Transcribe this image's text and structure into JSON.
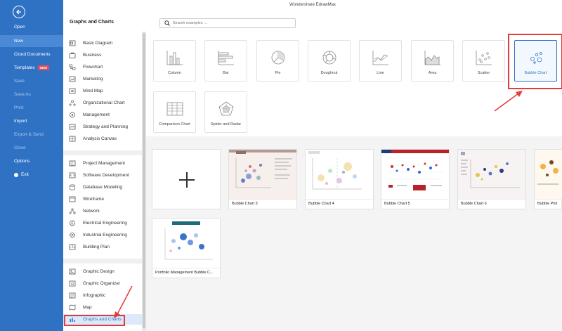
{
  "window": {
    "title": "Wondershare EdrawMax"
  },
  "leftnav": {
    "items": [
      {
        "label": "Open",
        "state": "normal"
      },
      {
        "label": "New",
        "state": "active"
      },
      {
        "label": "Cloud Documents",
        "state": "normal"
      },
      {
        "label": "Templates",
        "state": "normal",
        "badge": "NEW"
      },
      {
        "label": "Save",
        "state": "dim"
      },
      {
        "label": "Save As",
        "state": "dim"
      },
      {
        "label": "Print",
        "state": "dim"
      },
      {
        "label": "Import",
        "state": "normal"
      },
      {
        "label": "Export & Send",
        "state": "dim"
      },
      {
        "label": "Close",
        "state": "dim"
      },
      {
        "label": "Options",
        "state": "normal"
      },
      {
        "label": "Exit",
        "state": "normal"
      }
    ]
  },
  "header": {
    "section_title": "Graphs and Charts",
    "search_placeholder": "Search examples ..."
  },
  "categories": {
    "group1": [
      "Basic Diagram",
      "Business",
      "Flowchart",
      "Marketing",
      "Mind Map",
      "Organizational Chart",
      "Management",
      "Strategy and Planning",
      "Analysis Canvas"
    ],
    "group2": [
      "Project Management",
      "Software Development",
      "Database Modeling",
      "Wireframe",
      "Network",
      "Electrical Engineering",
      "Industrial Engineering",
      "Building Plan"
    ],
    "group3": [
      "Graphic Design",
      "Graphic Organizer",
      "Infographic",
      "Map",
      "Graphs and Charts"
    ],
    "selected": "Graphs and Charts"
  },
  "chart_types": [
    {
      "label": "Column",
      "icon": "column-chart-icon"
    },
    {
      "label": "Bar",
      "icon": "bar-chart-icon"
    },
    {
      "label": "Pie",
      "icon": "pie-chart-icon"
    },
    {
      "label": "Doughnut",
      "icon": "doughnut-chart-icon"
    },
    {
      "label": "Line",
      "icon": "line-chart-icon"
    },
    {
      "label": "Area",
      "icon": "area-chart-icon"
    },
    {
      "label": "Scatter",
      "icon": "scatter-chart-icon"
    },
    {
      "label": "Bubble Chart",
      "icon": "bubble-chart-icon",
      "selected": true
    },
    {
      "label": "Comparison Chart",
      "icon": "comparison-chart-icon"
    },
    {
      "label": "Spider and Radar",
      "icon": "radar-chart-icon"
    }
  ],
  "templates": [
    {
      "name": ""
    },
    {
      "name": "Bubble Chart 3"
    },
    {
      "name": "Bubble Chart 4"
    },
    {
      "name": "Bubble Chart 5"
    },
    {
      "name": "Bubble Chart 6"
    },
    {
      "name": "Bubble Plot"
    },
    {
      "name": "Portfolio Management Bubble C..."
    }
  ],
  "colors": {
    "nav_blue": "#2f72c4",
    "highlight_red": "#e23b3b",
    "selected_bg": "#dce9fa"
  }
}
